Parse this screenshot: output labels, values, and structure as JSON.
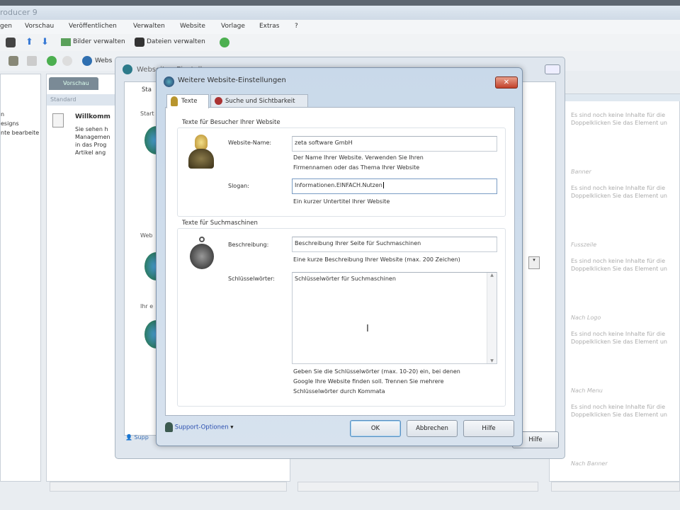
{
  "app": {
    "title": "roducer 9"
  },
  "menu": [
    "gen",
    "Vorschau",
    "Veröffentlichen",
    "Verwalten",
    "Website",
    "Vorlage",
    "Extras",
    "?"
  ],
  "toolbar": {
    "images_label": "Bilder verwalten",
    "files_label": "Dateien verwalten",
    "web_label": "Webs"
  },
  "left_panel": {
    "items": [
      "n",
      "esigns",
      "nte bearbeite"
    ]
  },
  "middle_panel": {
    "tab": "Vorschau",
    "header": "Standard",
    "welcome_title": "Willkomm",
    "welcome_lines": [
      "Sie sehen h",
      "Managemen",
      "in das Prog",
      "Artikel ang"
    ]
  },
  "bg_dialog": {
    "title": "Webseiten-Einstellungen",
    "tab": "Sta",
    "section1": "Start",
    "section2": "Web",
    "section3": "Ihr e",
    "support": "Supp",
    "help_btn": "Hilfe"
  },
  "right_panel": {
    "empty_text_1": "Es sind noch keine Inhalte für die",
    "empty_text_2": "Doppelklicken Sie das Element un",
    "sections": [
      "Banner",
      "Fusszeile",
      "Nach Logo",
      "Nach Menu",
      "Nach Banner"
    ]
  },
  "dialog": {
    "title": "Weitere Website-Einstellungen",
    "close": "✕",
    "tabs": [
      "Texte",
      "Suche und Sichtbarkeit"
    ],
    "group1": {
      "title": "Texte für Besucher Ihrer Website",
      "name_label": "Website-Name:",
      "name_value": "zeta software GmbH",
      "name_help_1": "Der Name Ihrer Website. Verwenden Sie Ihren",
      "name_help_2": "Firmennamen oder das Thema Ihrer Website",
      "slogan_label": "Slogan:",
      "slogan_value": "Informationen.EINFACH.Nutzen",
      "slogan_help": "Ein kurzer Untertitel Ihrer Website"
    },
    "group2": {
      "title": "Texte für Suchmaschinen",
      "desc_label": "Beschreibung:",
      "desc_value": "Beschreibung Ihrer Seite für Suchmaschinen",
      "desc_help": "Eine kurze Beschreibung Ihrer Website (max. 200 Zeichen)",
      "keywords_label": "Schlüsselwörter:",
      "keywords_value": "Schlüsselwörter für Suchmaschinen",
      "keywords_help_1": "Geben Sie die Schlüsselwörter (max. 10-20) ein, bei denen",
      "keywords_help_2": "Google Ihre Website finden soll. Trennen Sie mehrere",
      "keywords_help_3": "Schlüsselwörter durch Kommata"
    },
    "support": "Support-Optionen",
    "ok": "OK",
    "cancel": "Abbrechen",
    "help": "Hilfe"
  },
  "colors": {
    "accent": "#3b6fb5",
    "close": "#c2412a"
  }
}
